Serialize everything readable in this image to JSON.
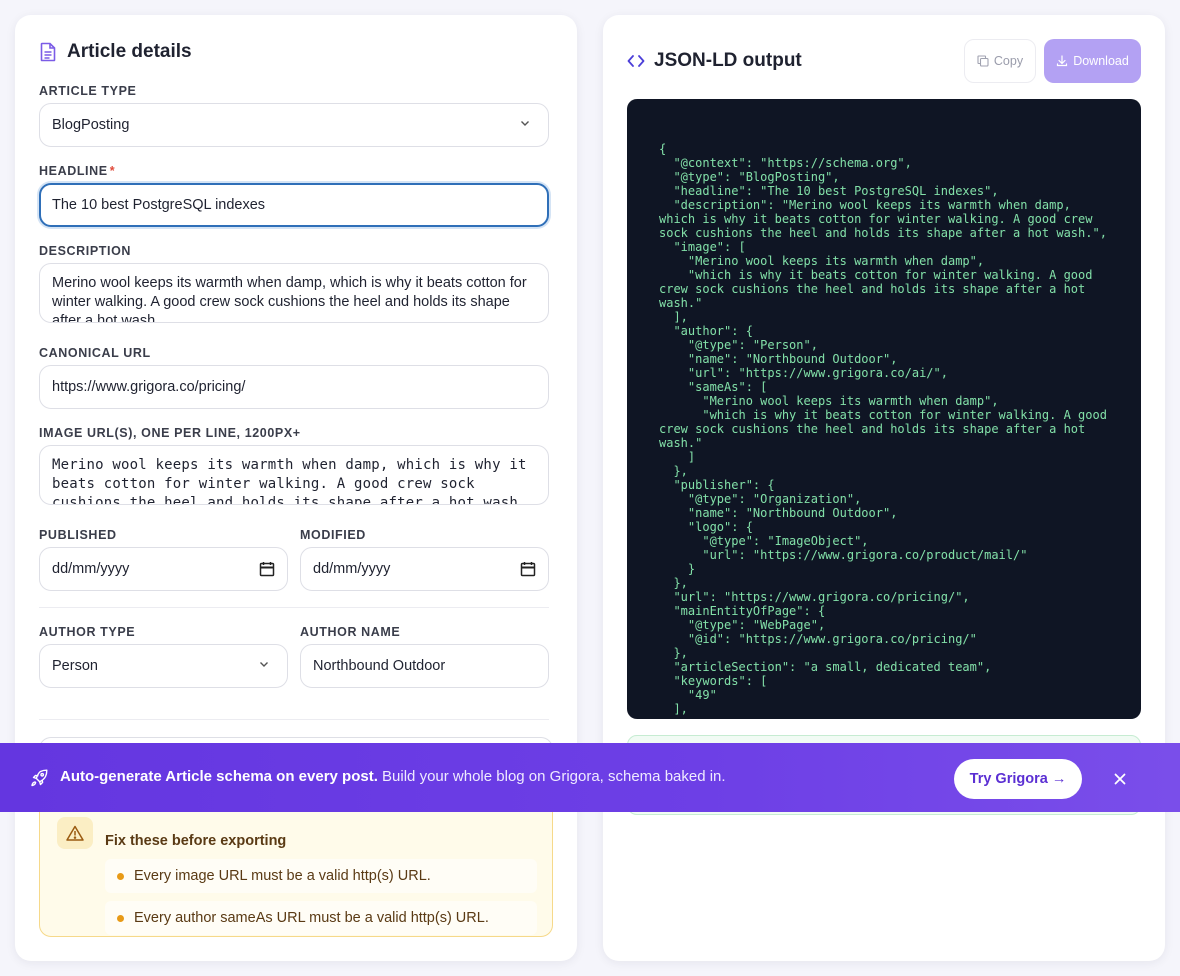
{
  "article_details": {
    "title": "Article details",
    "article_type": {
      "label": "ARTICLE TYPE",
      "value": "BlogPosting"
    },
    "headline": {
      "label": "HEADLINE",
      "required_marker": "*",
      "value": "The 10 best PostgreSQL indexes"
    },
    "description": {
      "label": "DESCRIPTION",
      "value": "Merino wool keeps its warmth when damp, which is why it beats cotton for winter walking. A good crew sock cushions the heel and holds its shape after a hot wash."
    },
    "canonical_url": {
      "label": "CANONICAL URL",
      "value": "https://www.grigora.co/pricing/"
    },
    "image_urls": {
      "label": "IMAGE URL(S), ONE PER LINE, 1200PX+",
      "value": "Merino wool keeps its warmth when damp, which is why it beats cotton for winter walking. A good crew sock cushions the heel and holds its shape after a hot wash."
    },
    "published": {
      "label": "PUBLISHED",
      "placeholder": "dd/mm/yyyy"
    },
    "modified": {
      "label": "MODIFIED",
      "placeholder": "dd/mm/yyyy"
    },
    "author_type": {
      "label": "AUTHOR TYPE",
      "value": "Person"
    },
    "author_name": {
      "label": "AUTHOR NAME",
      "value": "Northbound Outdoor"
    }
  },
  "warnings": {
    "title": "Fix these before exporting",
    "items": [
      "Every image URL must be a valid http(s) URL.",
      "Every author sameAs URL must be a valid http(s) URL."
    ]
  },
  "output": {
    "title": "JSON-LD output",
    "copy_label": "Copy",
    "download_label": "Download",
    "code": "{\n  \"@context\": \"https://schema.org\",\n  \"@type\": \"BlogPosting\",\n  \"headline\": \"The 10 best PostgreSQL indexes\",\n  \"description\": \"Merino wool keeps its warmth when damp,\nwhich is why it beats cotton for winter walking. A good crew\nsock cushions the heel and holds its shape after a hot wash.\",\n  \"image\": [\n    \"Merino wool keeps its warmth when damp\",\n    \"which is why it beats cotton for winter walking. A good\ncrew sock cushions the heel and holds its shape after a hot\nwash.\"\n  ],\n  \"author\": {\n    \"@type\": \"Person\",\n    \"name\": \"Northbound Outdoor\",\n    \"url\": \"https://www.grigora.co/ai/\",\n    \"sameAs\": [\n      \"Merino wool keeps its warmth when damp\",\n      \"which is why it beats cotton for winter walking. A good\ncrew sock cushions the heel and holds its shape after a hot\nwash.\"\n    ]\n  },\n  \"publisher\": {\n    \"@type\": \"Organization\",\n    \"name\": \"Northbound Outdoor\",\n    \"logo\": {\n      \"@type\": \"ImageObject\",\n      \"url\": \"https://www.grigora.co/product/mail/\"\n    }\n  },\n  \"url\": \"https://www.grigora.co/pricing/\",\n  \"mainEntityOfPage\": {\n    \"@type\": \"WebPage\",\n    \"@id\": \"https://www.grigora.co/pricing/\"\n  },\n  \"articleSection\": \"a small, dedicated team\",\n  \"keywords\": [\n    \"49\"\n  ],"
  },
  "banner": {
    "bold_text": "Auto-generate Article schema on every post.",
    "text": " Build your whole blog on Grigora, schema baked in.",
    "cta_label": "Try Grigora →"
  },
  "colors": {
    "accent": "#6436e0",
    "download_button": "#b3a1f3",
    "code_background": "#0f1524",
    "code_text": "#82e0a8",
    "warning_background": "#fffbea",
    "focus_border": "#2f6fb8"
  },
  "icons": {
    "title": "document-icon",
    "output": "code-brackets-icon",
    "copy": "copy-icon",
    "download": "download-icon",
    "warning": "warning-triangle-icon",
    "banner": "rocket-icon",
    "close": "close-icon",
    "select": "chevron-down-icon",
    "date": "calendar-icon"
  }
}
